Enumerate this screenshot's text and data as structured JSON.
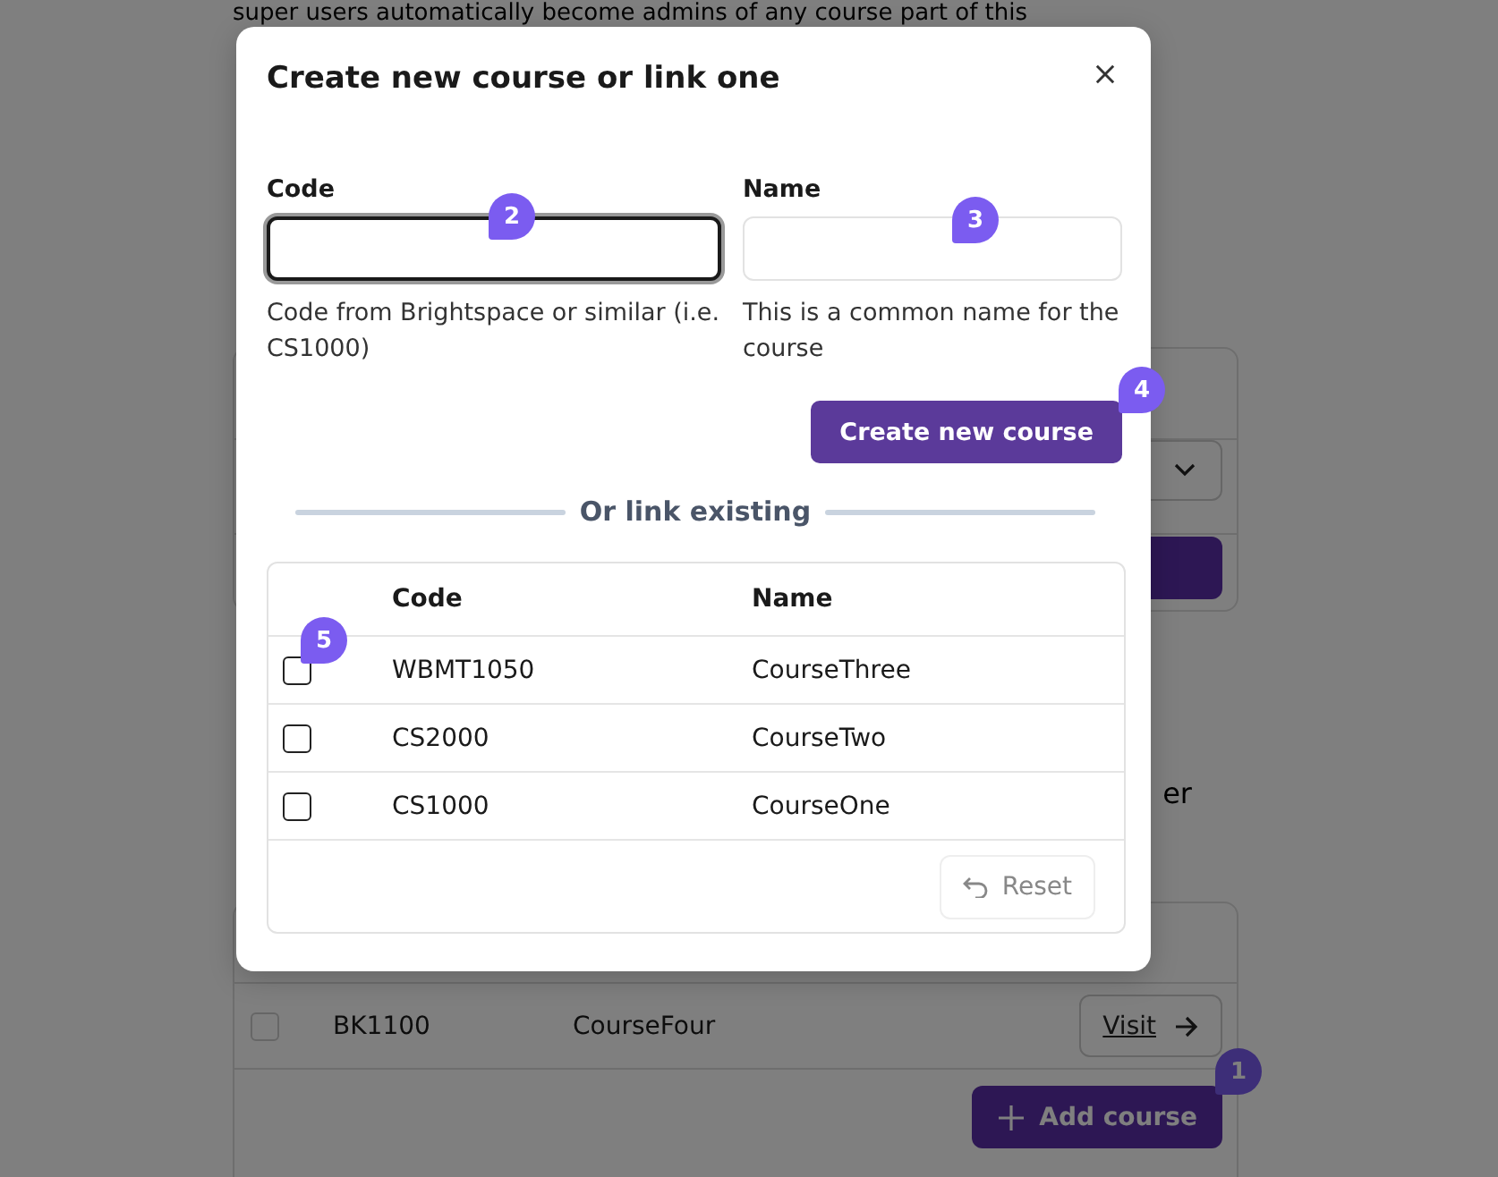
{
  "background": {
    "intro_text": "super users automatically become admins of any course part of this",
    "text_fragment": "er",
    "courses_table": {
      "rows": [
        {
          "checked": false,
          "code": "BK1100",
          "name": "CourseFour",
          "action": "Visit"
        }
      ]
    },
    "add_button": {
      "label": "Add course",
      "badge": "1"
    }
  },
  "dialog": {
    "title": "Create new course or link one",
    "fields": [
      {
        "label": "Code",
        "focused": true,
        "help": "Code from Brightspace or similar (i.e. CS1000)",
        "badge": "2"
      },
      {
        "label": "Name",
        "focused": false,
        "help": "This is a common name for the course",
        "badge": "3"
      }
    ],
    "create_button": {
      "label": "Create new course",
      "badge": "4"
    },
    "divider": "Or link existing",
    "table": {
      "badge": "5",
      "columns": [
        "Code",
        "Name"
      ],
      "rows": [
        {
          "checked": false,
          "code": "WBMT1050",
          "name": "CourseThree"
        },
        {
          "checked": false,
          "code": "CS2000",
          "name": "CourseTwo"
        },
        {
          "checked": false,
          "code": "CS1000",
          "name": "CourseOne"
        }
      ]
    },
    "reset_button": {
      "label": "Reset",
      "disabled": true
    }
  }
}
